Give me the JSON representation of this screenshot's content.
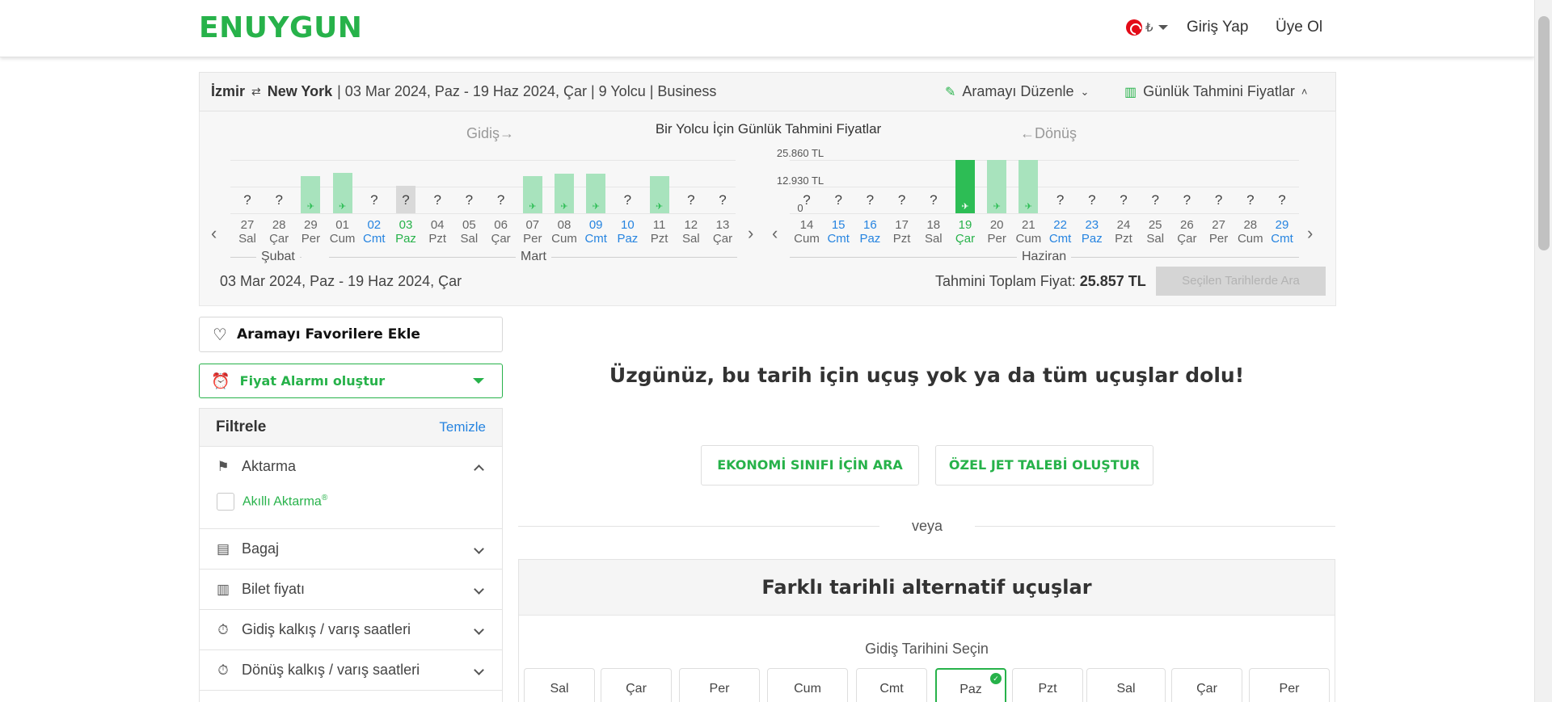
{
  "header": {
    "logo": "ENUYGUN",
    "currency": "₺",
    "login": "Giriş Yap",
    "signup": "Üye Ol"
  },
  "summary": {
    "origin": "İzmir",
    "destination": "New York",
    "details": "| 03 Mar 2024, Paz - 19 Haz 2024, Çar | 9 Yolcu | Business",
    "edit_search": "Aramayı Düzenle",
    "daily_prices": "Günlük Tahmini Fiyatlar"
  },
  "calendar": {
    "title": "Bir Yolcu İçin Günlük Tahmini Fiyatlar",
    "outbound_label": "Gidiş",
    "return_label": "Dönüş",
    "y_ticks": [
      "25.860 TL",
      "12.930 TL",
      "0"
    ],
    "outbound_days": [
      {
        "d": "27",
        "w": "Sal",
        "level": 0,
        "color": "normal"
      },
      {
        "d": "28",
        "w": "Çar",
        "level": 0,
        "color": "normal"
      },
      {
        "d": "29",
        "w": "Per",
        "level": 0.7,
        "color": "normal"
      },
      {
        "d": "01",
        "w": "Cum",
        "level": 0.75,
        "color": "normal"
      },
      {
        "d": "02",
        "w": "Cmt",
        "level": 0,
        "color": "blue"
      },
      {
        "d": "03",
        "w": "Paz",
        "level": 0,
        "color": "green",
        "selected": true
      },
      {
        "d": "04",
        "w": "Pzt",
        "level": 0,
        "color": "normal"
      },
      {
        "d": "05",
        "w": "Sal",
        "level": 0,
        "color": "normal"
      },
      {
        "d": "06",
        "w": "Çar",
        "level": 0,
        "color": "normal"
      },
      {
        "d": "07",
        "w": "Per",
        "level": 0.7,
        "color": "normal"
      },
      {
        "d": "08",
        "w": "Cum",
        "level": 0.74,
        "color": "normal"
      },
      {
        "d": "09",
        "w": "Cmt",
        "level": 0.74,
        "color": "blue"
      },
      {
        "d": "10",
        "w": "Paz",
        "level": 0,
        "color": "blue"
      },
      {
        "d": "11",
        "w": "Pzt",
        "level": 0.7,
        "color": "normal"
      },
      {
        "d": "12",
        "w": "Sal",
        "level": 0,
        "color": "normal"
      },
      {
        "d": "13",
        "w": "Çar",
        "level": 0,
        "color": "normal"
      }
    ],
    "return_days": [
      {
        "d": "14",
        "w": "Cum",
        "level": 0,
        "color": "normal"
      },
      {
        "d": "15",
        "w": "Cmt",
        "level": 0,
        "color": "blue"
      },
      {
        "d": "16",
        "w": "Paz",
        "level": 0,
        "color": "blue"
      },
      {
        "d": "17",
        "w": "Pzt",
        "level": 0,
        "color": "normal"
      },
      {
        "d": "18",
        "w": "Sal",
        "level": 0,
        "color": "normal"
      },
      {
        "d": "19",
        "w": "Çar",
        "level": 1.0,
        "color": "green",
        "selected": true
      },
      {
        "d": "20",
        "w": "Per",
        "level": 1.0,
        "color": "normal"
      },
      {
        "d": "21",
        "w": "Cum",
        "level": 1.0,
        "color": "normal"
      },
      {
        "d": "22",
        "w": "Cmt",
        "level": 0,
        "color": "blue"
      },
      {
        "d": "23",
        "w": "Paz",
        "level": 0,
        "color": "blue"
      },
      {
        "d": "24",
        "w": "Pzt",
        "level": 0,
        "color": "normal"
      },
      {
        "d": "25",
        "w": "Sal",
        "level": 0,
        "color": "normal"
      },
      {
        "d": "26",
        "w": "Çar",
        "level": 0,
        "color": "normal"
      },
      {
        "d": "27",
        "w": "Per",
        "level": 0,
        "color": "normal"
      },
      {
        "d": "28",
        "w": "Cum",
        "level": 0,
        "color": "normal"
      },
      {
        "d": "29",
        "w": "Cmt",
        "level": 0,
        "color": "blue"
      }
    ],
    "unknown_mark": "?",
    "months": {
      "feb": "Şubat",
      "mar": "Mart",
      "jun": "Haziran"
    },
    "selected_dates": "03 Mar 2024, Paz - 19 Haz 2024, Çar",
    "total_label": "Tahmini Toplam Fiyat:",
    "total_value": "25.857 TL",
    "search_button": "Seçilen Tarihlerde Ara"
  },
  "sidebar": {
    "favorite_button": "Aramayı Favorilere Ekle",
    "alarm_button": "Fiyat Alarmı oluştur",
    "filter_title": "Filtrele",
    "clear": "Temizle",
    "sections": [
      {
        "label": "Aktarma",
        "icon": "flag-icon",
        "expanded": true
      },
      {
        "label": "Bagaj",
        "icon": "luggage-icon",
        "expanded": false
      },
      {
        "label": "Bilet fiyatı",
        "icon": "bar-chart-icon",
        "expanded": false
      },
      {
        "label": "Gidiş kalkış / varış saatleri",
        "icon": "stopwatch-icon",
        "expanded": false
      },
      {
        "label": "Dönüş kalkış / varış saatleri",
        "icon": "stopwatch-icon",
        "expanded": false
      }
    ],
    "smart_transfer": "Akıllı Aktarma",
    "smart_transfer_mark": "®"
  },
  "main": {
    "sorry": "Üzgünüz, bu tarih için uçuş yok ya da tüm uçuşlar dolu!",
    "economy_button": "EKONOMİ SINIFI İÇİN ARA",
    "jet_button": "ÖZEL JET TALEBİ OLUŞTUR",
    "or": "veya",
    "alt_title": "Farklı tarihli alternatif uçuşlar",
    "alt_subtitle": "Gidiş Tarihini Seçin",
    "date_cards": [
      "Sal",
      "Çar",
      "Per",
      "Cum",
      "Cmt",
      "Paz",
      "Pzt",
      "Sal",
      "Çar",
      "Per"
    ],
    "active_card_index": 5
  },
  "colors": {
    "brand": "#27b24a",
    "link_blue": "#2684e0",
    "bar": "#a8e3bd",
    "bar_selected": "#2dbd55"
  }
}
